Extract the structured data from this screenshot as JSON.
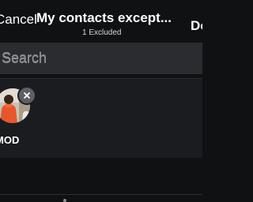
{
  "header": {
    "cancel_label": "Cancel",
    "title": "My contacts except...",
    "subtitle": "1 Excluded",
    "done_label": "Done"
  },
  "search": {
    "placeholder": "Search",
    "value": ""
  },
  "excluded": [
    {
      "name": "MOD"
    }
  ],
  "colors": {
    "background": "#101113",
    "search_field": "#2b2c30",
    "strip": "#1b1c1f",
    "placeholder_text": "#8e8e93",
    "remove_badge": "#5e5f64"
  },
  "icons": {
    "remove": "close-icon",
    "avatar": "contact-photo"
  }
}
